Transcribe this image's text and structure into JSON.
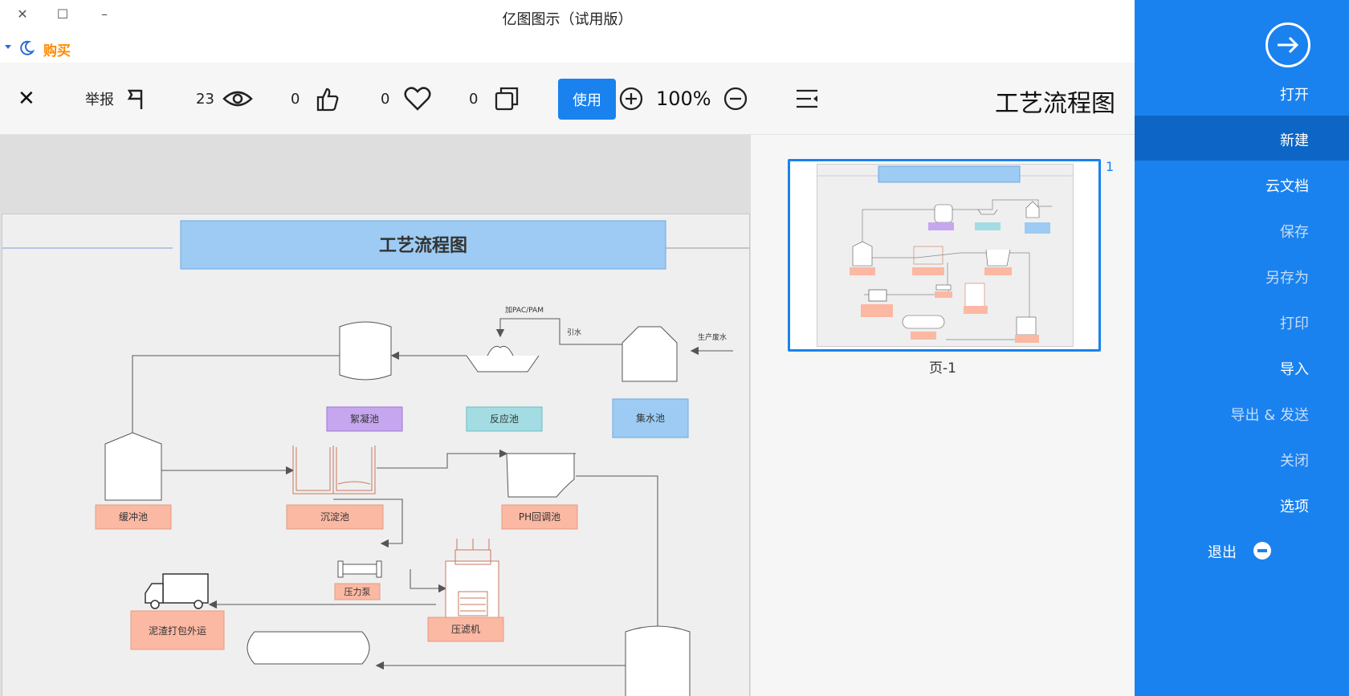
{
  "window": {
    "title": "亿图图示（试用版）",
    "close_glyph": "✕",
    "maximize_glyph": "☐",
    "minimize_glyph": "–"
  },
  "buy": {
    "label": "购买"
  },
  "toolbar": {
    "report_label": "举报",
    "views_count": "23",
    "likes_count": "0",
    "favorites_count": "0",
    "copies_count": "0",
    "use_label": "使用",
    "zoom_level": "100%",
    "doc_title": "工艺流程图",
    "close_glyph": "✕"
  },
  "diagram": {
    "title": "工艺流程图",
    "labels": {
      "collect_pool": "集水池",
      "react_pool": "反应池",
      "coag_pool": "絮凝池",
      "buffer_pool": "缓冲池",
      "settle_pool": "沉淀池",
      "ph_pool": "PH回调池",
      "press_pump": "压力泵",
      "filter_press": "压滤机",
      "sludge_out": "泥渣打包外运",
      "source_water": "生产废水",
      "lift": "引水",
      "dosing": "加PAC/PAM"
    }
  },
  "thumbnail": {
    "page_number": "1",
    "page_label": "页-1"
  },
  "sidebar": {
    "items": [
      {
        "label": "打开"
      },
      {
        "label": "新建"
      },
      {
        "label": "云文档"
      },
      {
        "label": "保存"
      },
      {
        "label": "另存为"
      },
      {
        "label": "打印"
      },
      {
        "label": "导入"
      },
      {
        "label": "导出 & 发送"
      },
      {
        "label": "关闭"
      },
      {
        "label": "选项"
      },
      {
        "label": "退出"
      }
    ]
  },
  "colors": {
    "accent": "#1a82ef",
    "buy": "#ff8a00",
    "title_box": "#9dcbf3",
    "salmon": "#fbb8a3",
    "purple": "#c6a6ef",
    "teal": "#a3dde3"
  }
}
